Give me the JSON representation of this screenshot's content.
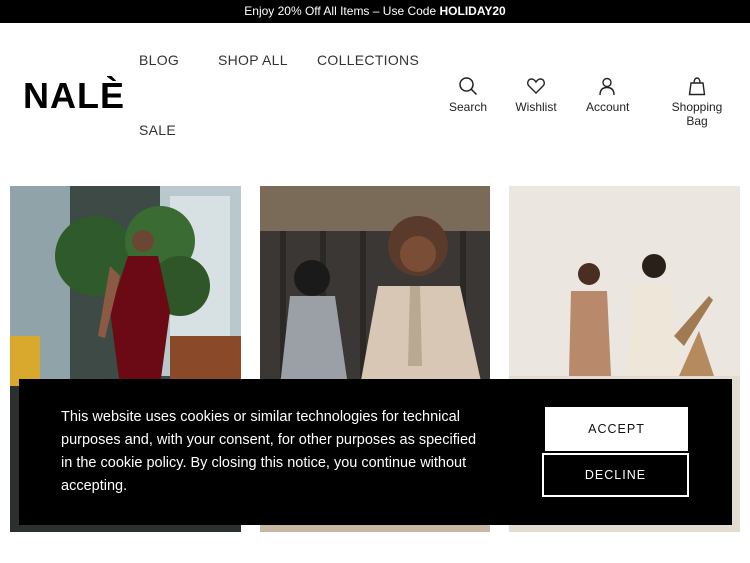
{
  "promo": {
    "prefix": "Enjoy 20% Off All Items – Use Code ",
    "code": "HOLIDAY20"
  },
  "brand": {
    "logo": "NALÈ"
  },
  "nav": {
    "blog": "BLOG",
    "shop_all": "SHOP ALL",
    "collections": "COLLECTIONS",
    "sale": "SALE"
  },
  "tools": {
    "search": "Search",
    "wishlist": "Wishlist",
    "account": "Account",
    "bag": "Shopping Bag"
  },
  "cookie": {
    "text": "This website uses cookies or similar technologies for technical purposes and, with your consent, for other purposes as specified in the cookie policy. By closing this notice, you continue without accepting.",
    "accept": "ACCEPT",
    "decline": "DECLINE"
  },
  "colors": {
    "banner": "#000000",
    "background": "#ffffff",
    "accent": "#6b0a14"
  }
}
